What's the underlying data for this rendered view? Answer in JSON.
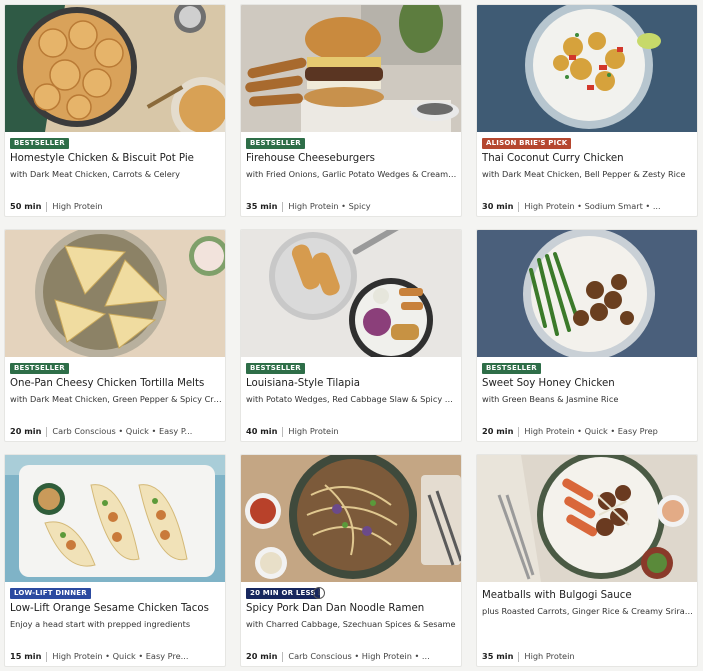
{
  "colors": {
    "bestseller": "#2e6e48",
    "celebrity": "#b5472f",
    "lowlift": "#2b4aa0",
    "quick": "#17275e"
  },
  "recipes": [
    {
      "badge": "BESTSELLER",
      "badge_kind": "bestseller",
      "title": "Homestyle Chicken & Biscuit Pot Pie",
      "subtitle": "with Dark Meat Chicken, Carrots & Celery",
      "time": "50 min",
      "tags": "High Protein",
      "photo": "pot-pie-photo"
    },
    {
      "badge": "BESTSELLER",
      "badge_kind": "bestseller",
      "title": "Firehouse Cheeseburgers",
      "subtitle": "with Fried Onions, Garlic Potato Wedges & Creamy ...",
      "time": "35 min",
      "tags": "High Protein • Spicy",
      "photo": "cheeseburger-photo"
    },
    {
      "badge": "ALISON BRIE'S PICK",
      "badge_kind": "celebrity",
      "title": "Thai Coconut Curry Chicken",
      "subtitle": "with Dark Meat Chicken, Bell Pepper & Zesty Rice",
      "time": "30 min",
      "tags": "High Protein • Sodium Smart • ...",
      "photo": "curry-photo"
    },
    {
      "badge": "BESTSELLER",
      "badge_kind": "bestseller",
      "title": "One-Pan Cheesy Chicken Tortilla Melts",
      "subtitle": "with Dark Meat Chicken, Green Pepper & Spicy Cre...",
      "time": "20 min",
      "tags": "Carb Conscious • Quick • Easy P...",
      "photo": "tortilla-melts-photo"
    },
    {
      "badge": "BESTSELLER",
      "badge_kind": "bestseller",
      "title": "Louisiana-Style Tilapia",
      "subtitle": "with Potato Wedges, Red Cabbage Slaw & Spicy Re...",
      "time": "40 min",
      "tags": "High Protein",
      "photo": "tilapia-photo"
    },
    {
      "badge": "BESTSELLER",
      "badge_kind": "bestseller",
      "title": "Sweet Soy Honey Chicken",
      "subtitle": "with Green Beans & Jasmine Rice",
      "time": "20 min",
      "tags": "High Protein • Quick • Easy Prep",
      "photo": "honey-chicken-photo"
    },
    {
      "badge": "LOW-LIFT DINNER",
      "badge_kind": "lowlift",
      "title": "Low-Lift Orange Sesame Chicken Tacos",
      "subtitle": "Enjoy a head start with prepped ingredients",
      "time": "15 min",
      "tags": "High Protein • Quick • Easy Pre...",
      "photo": "tacos-photo"
    },
    {
      "badge": "20 MIN OR LESS",
      "badge_kind": "quick",
      "title": "Spicy Pork Dan Dan Noodle Ramen",
      "subtitle": "with Charred Cabbage, Szechuan Spices & Sesame",
      "time": "20 min",
      "tags": "Carb Conscious • High Protein • ...",
      "photo": "ramen-photo",
      "info_icon": "info-icon"
    },
    {
      "badge": "",
      "badge_kind": "",
      "title": "Meatballs with Bulgogi Sauce",
      "subtitle": "plus Roasted Carrots, Ginger Rice & Creamy Sriracha",
      "time": "35 min",
      "tags": "High Protein",
      "photo": "meatballs-photo"
    }
  ]
}
